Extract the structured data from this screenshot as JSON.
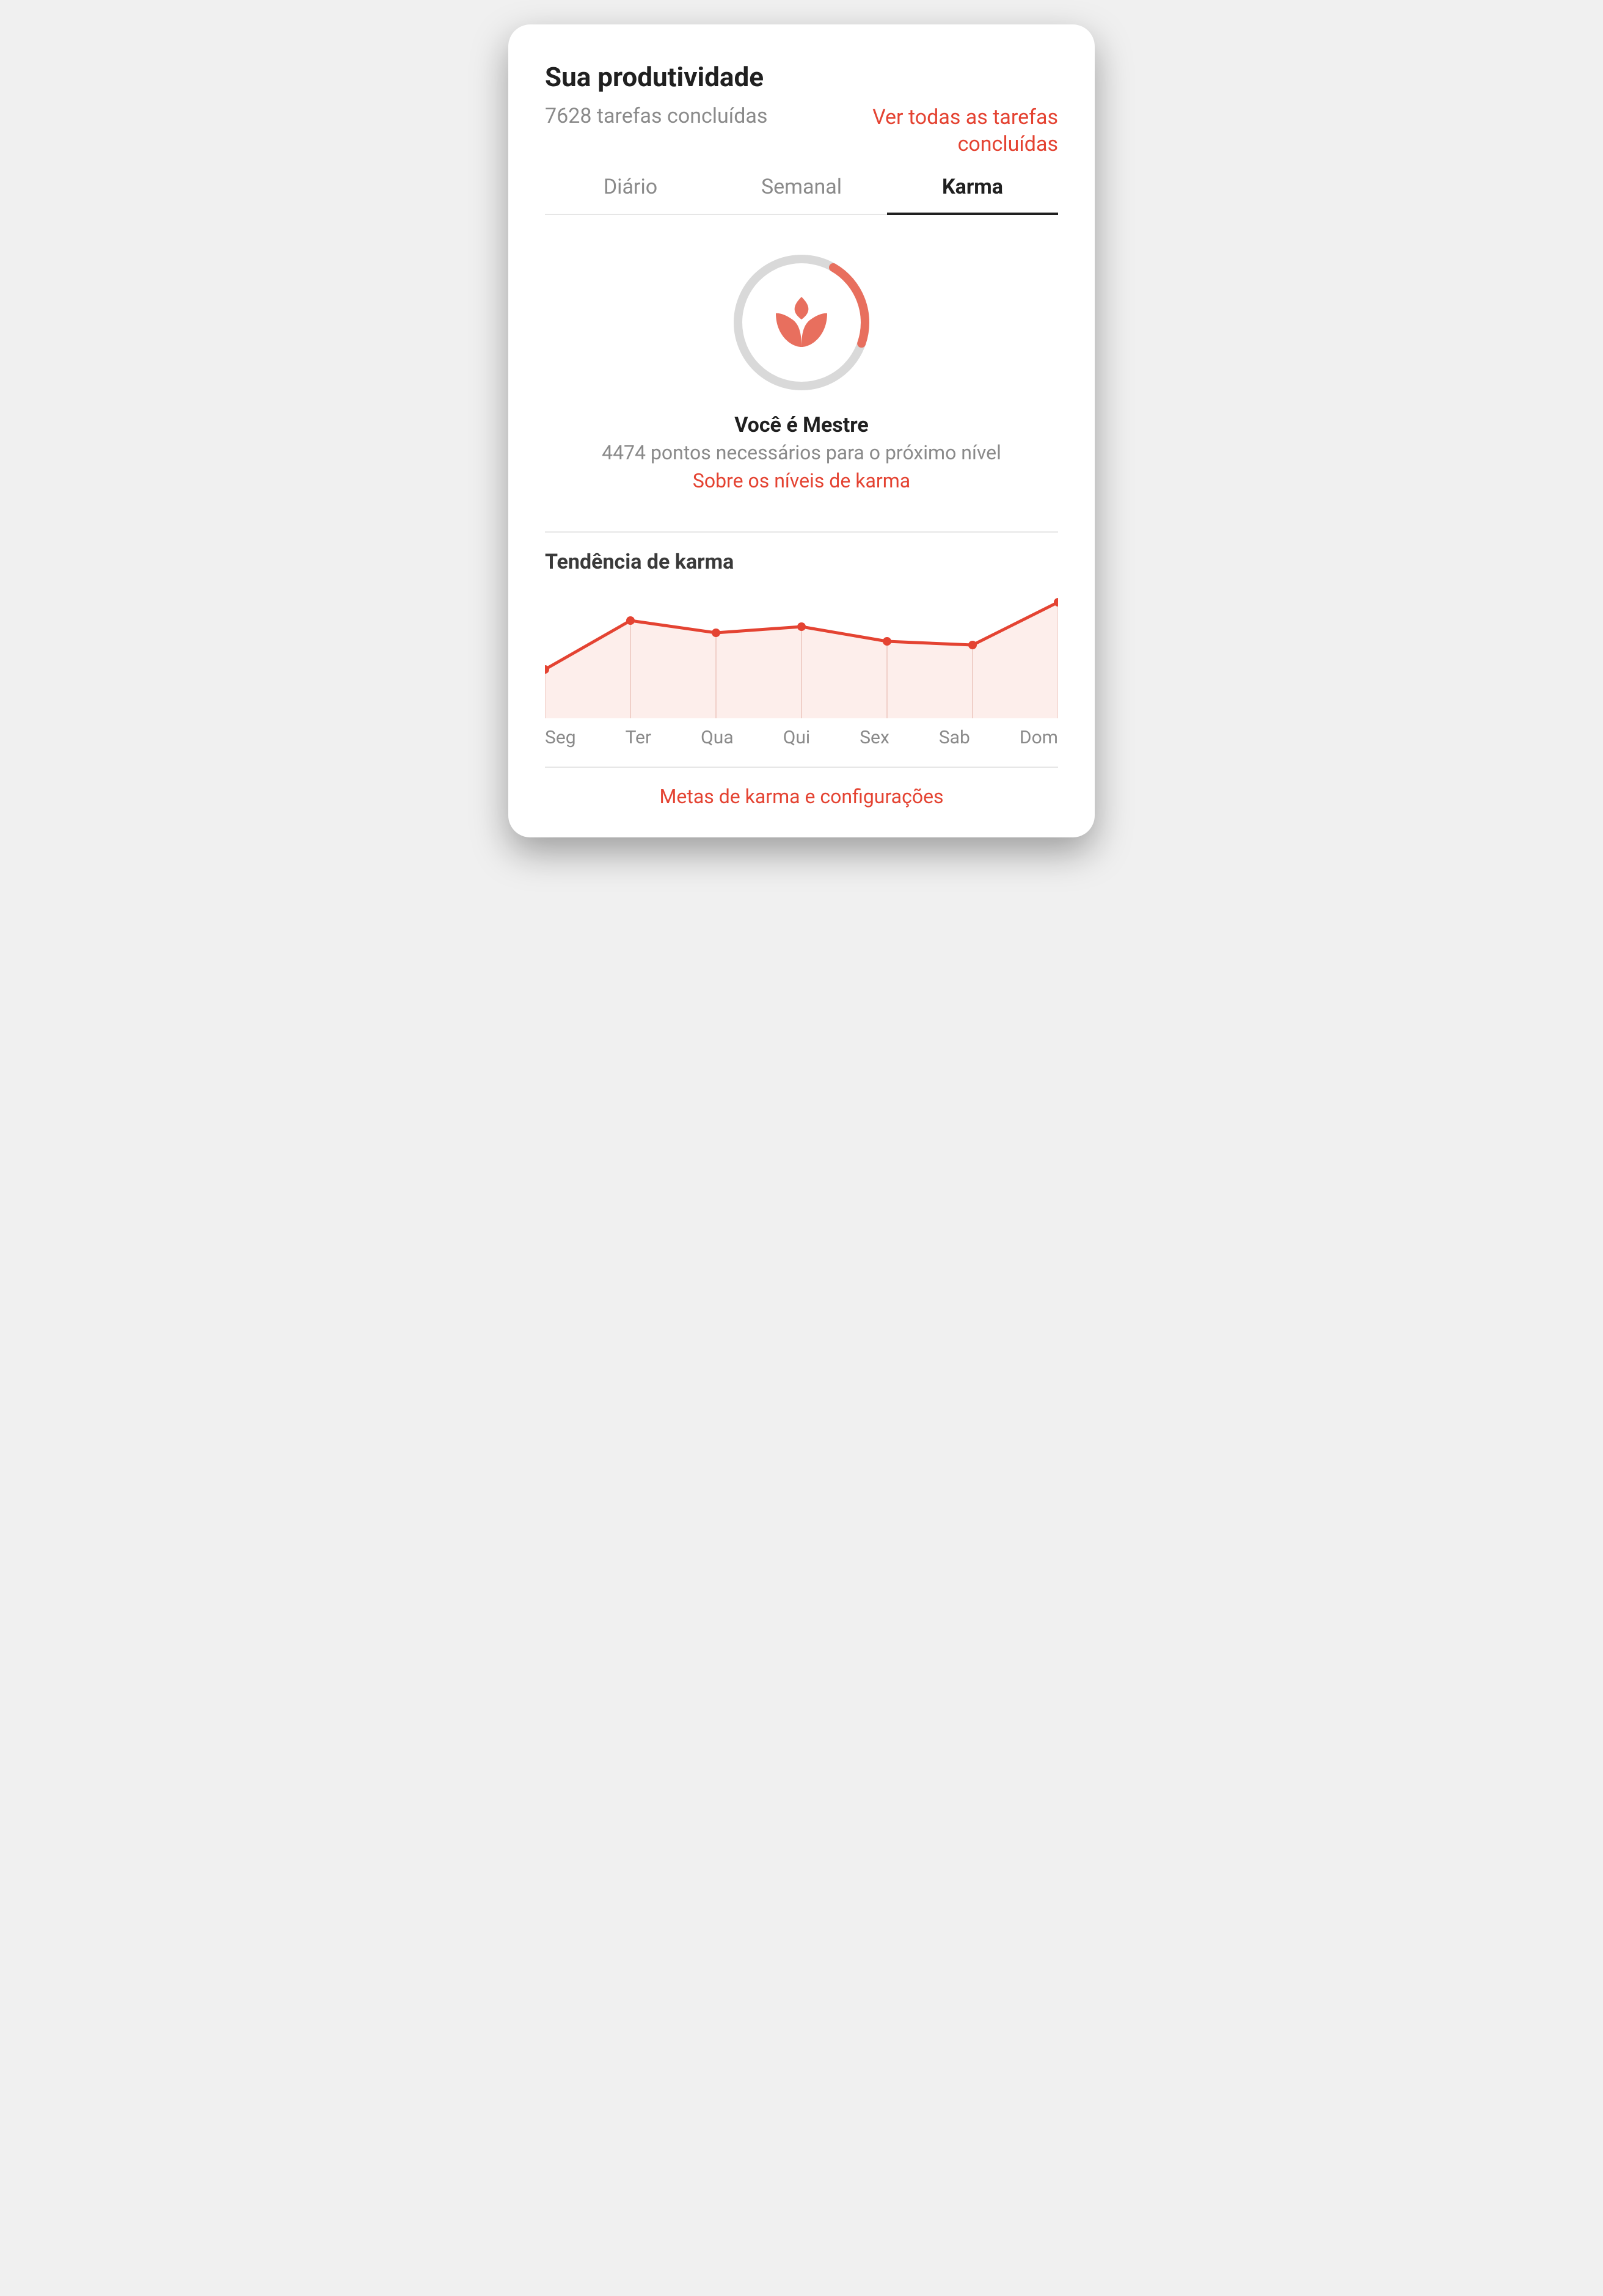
{
  "header": {
    "title": "Sua produtividade",
    "tasks_completed_text": "7628 tarefas concluídas",
    "see_all_link": "Ver todas as tarefas concluídas"
  },
  "tabs": {
    "daily": "Diário",
    "weekly": "Semanal",
    "karma": "Karma",
    "active": "karma"
  },
  "karma": {
    "level_title": "Você é Mestre",
    "points_to_next": "4474 pontos necessários para o próximo nível",
    "about_link": "Sobre os níveis de karma",
    "ring_progress_percent": 22
  },
  "trend": {
    "title": "Tendência de karma"
  },
  "footer": {
    "settings_link": "Metas de karma e configurações"
  },
  "colors": {
    "accent": "#e44332",
    "muted": "#8a8a8a",
    "ring_bg": "#d9d9d9"
  },
  "chart_data": {
    "type": "line",
    "categories": [
      "Seg",
      "Ter",
      "Qua",
      "Qui",
      "Sex",
      "Sab",
      "Dom"
    ],
    "values": [
      35,
      75,
      65,
      70,
      58,
      55,
      90
    ],
    "title": "Tendência de karma",
    "xlabel": "",
    "ylabel": "",
    "ylim": [
      0,
      100
    ]
  }
}
